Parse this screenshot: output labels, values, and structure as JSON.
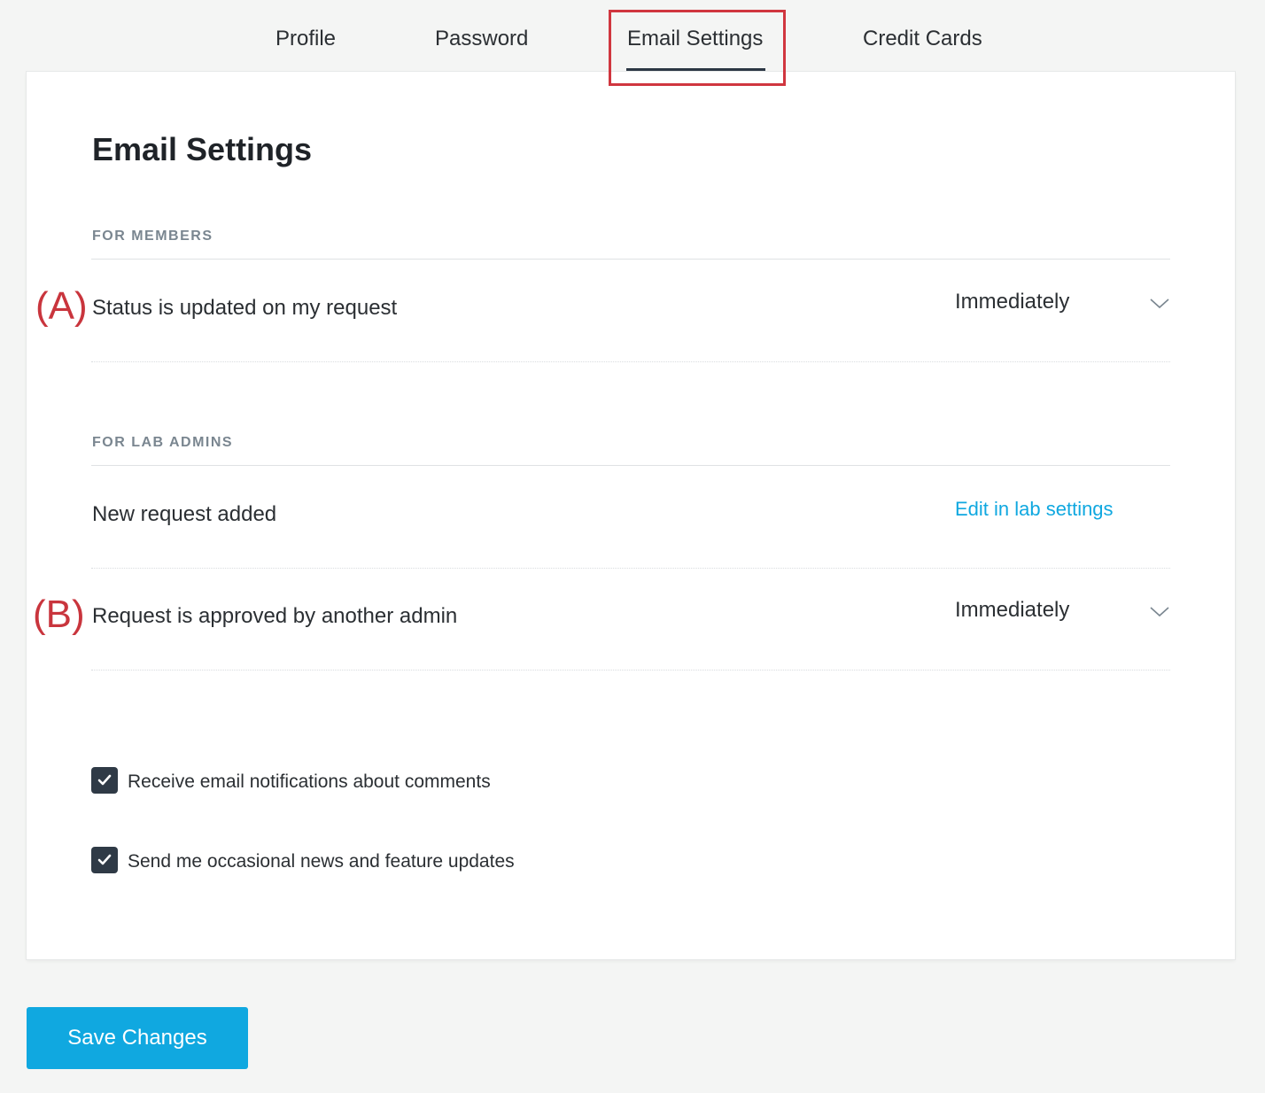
{
  "tabs": [
    {
      "label": "Profile"
    },
    {
      "label": "Password"
    },
    {
      "label": "Email Settings",
      "active": true
    },
    {
      "label": "Credit Cards"
    }
  ],
  "page_title": "Email Settings",
  "sections": {
    "members": {
      "heading": "FOR MEMBERS",
      "rows": [
        {
          "annotation": "(A)",
          "label": "Status is updated on my request",
          "value": "Immediately",
          "icon": "chevron-down-icon"
        }
      ]
    },
    "lab_admins": {
      "heading": "FOR LAB ADMINS",
      "rows": [
        {
          "label": "New request added",
          "link": "Edit in lab settings"
        },
        {
          "annotation": "(B)",
          "label": "Request is approved by another admin",
          "value": "Immediately",
          "icon": "chevron-down-icon"
        }
      ]
    }
  },
  "checkboxes": [
    {
      "label": "Receive email notifications about comments",
      "checked": true
    },
    {
      "label": "Send me occasional news and feature updates",
      "checked": true
    }
  ],
  "save_label": "Save Changes",
  "colors": {
    "accent": "#10a8e0",
    "annotation": "#c9353d",
    "highlight": "#d0363f",
    "checkbox": "#2f3a46"
  }
}
